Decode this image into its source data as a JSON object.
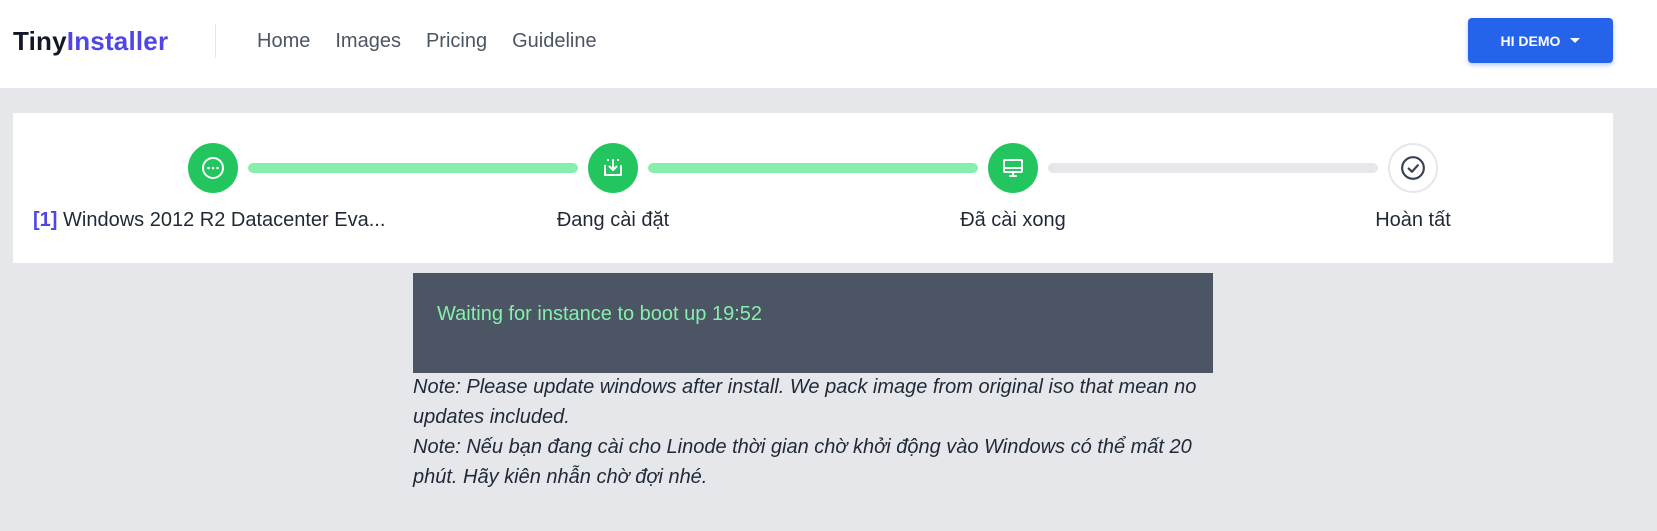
{
  "brand": {
    "part1": "Tiny",
    "part2": "Installer"
  },
  "nav": {
    "items": [
      "Home",
      "Images",
      "Pricing",
      "Guideline"
    ]
  },
  "user_menu": {
    "label": "HI DEMO"
  },
  "stepper": {
    "image_index": "[1]",
    "image_name": "Windows 2012 R2 Datacenter Eva...",
    "steps": [
      "Đang cài đặt",
      "Đã cài xong",
      "Hoàn tất"
    ],
    "bar_progress": [
      1.0,
      1.0,
      0.0
    ]
  },
  "console": {
    "status": "Waiting for instance to boot up 19:52"
  },
  "notes": [
    "Note: Please update windows after install. We pack image from original iso that mean no updates included.",
    "Note: Nếu bạn đang cài cho Linode thời gian chờ khởi động vào Windows có thể mất 20 phút. Hãy kiên nhẫn chờ đợi nhé."
  ],
  "colors": {
    "accent": "#2563eb",
    "brand": "#4f46e5",
    "success": "#22c55e",
    "progress": "#86efac",
    "console_bg": "#4b5563"
  }
}
